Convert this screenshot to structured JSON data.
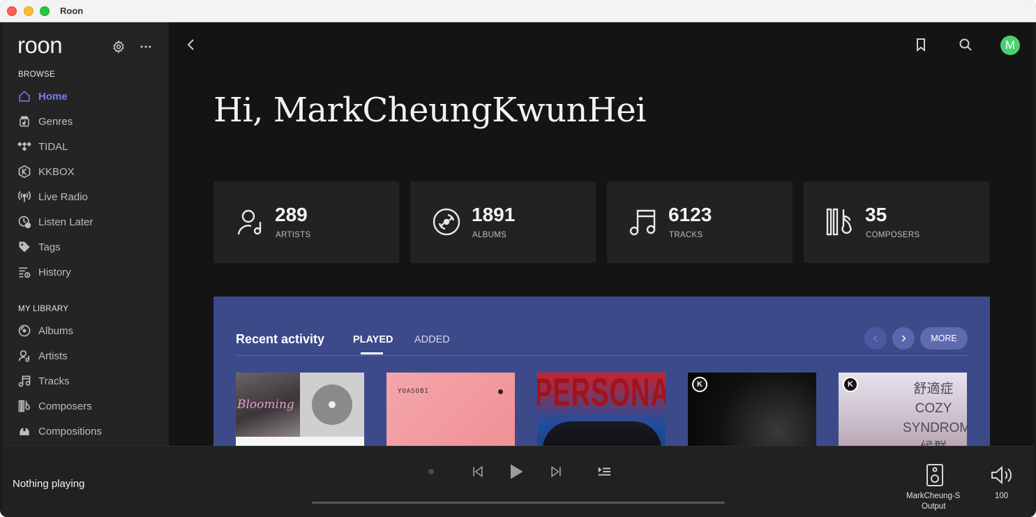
{
  "window": {
    "title": "Roon"
  },
  "sidebar": {
    "logo_text": "roon",
    "browse_heading": "BROWSE",
    "browse_items": [
      {
        "label": "Home",
        "icon": "home-icon",
        "active": true
      },
      {
        "label": "Genres",
        "icon": "genres-icon"
      },
      {
        "label": "TIDAL",
        "icon": "tidal-icon"
      },
      {
        "label": "KKBOX",
        "icon": "kkbox-icon"
      },
      {
        "label": "Live Radio",
        "icon": "radio-icon"
      },
      {
        "label": "Listen Later",
        "icon": "listen-later-icon"
      },
      {
        "label": "Tags",
        "icon": "tag-icon"
      },
      {
        "label": "History",
        "icon": "history-icon"
      }
    ],
    "library_heading": "MY LIBRARY",
    "library_items": [
      {
        "label": "Albums",
        "icon": "album-icon"
      },
      {
        "label": "Artists",
        "icon": "artist-icon"
      },
      {
        "label": "Tracks",
        "icon": "music-note-icon"
      },
      {
        "label": "Composers",
        "icon": "composer-icon"
      },
      {
        "label": "Compositions",
        "icon": "composition-icon"
      }
    ]
  },
  "header": {
    "avatar_initial": "M"
  },
  "main": {
    "greeting": "Hi, MarkCheungKwunHei",
    "stats": [
      {
        "value": "289",
        "label": "ARTISTS",
        "icon": "artist-icon"
      },
      {
        "value": "1891",
        "label": "ALBUMS",
        "icon": "album-icon"
      },
      {
        "value": "6123",
        "label": "TRACKS",
        "icon": "music-note-icon"
      },
      {
        "value": "35",
        "label": "COMPOSERS",
        "icon": "composer-icon"
      }
    ],
    "activity": {
      "title": "Recent activity",
      "tabs": [
        "PLAYED",
        "ADDED"
      ],
      "active_tab": "PLAYED",
      "more_label": "MORE",
      "covers": [
        {
          "text": "Blooming",
          "kkbox": false
        },
        {
          "text": "YOASOBI",
          "kkbox": false
        },
        {
          "text": "PERSONA WITHIN",
          "kkbox": false
        },
        {
          "text": "",
          "kkbox": true
        },
        {
          "text": "舒適症 COZY SYNDROME 候群",
          "kkbox": true
        }
      ],
      "accent_color": "#3d4a8a"
    }
  },
  "player": {
    "status": "Nothing playing",
    "zone_name": "MarkCheung-S",
    "zone_sub": "Output",
    "volume": "100"
  },
  "colors": {
    "accent": "#7a7cf0",
    "avatar": "#4ad16b"
  }
}
